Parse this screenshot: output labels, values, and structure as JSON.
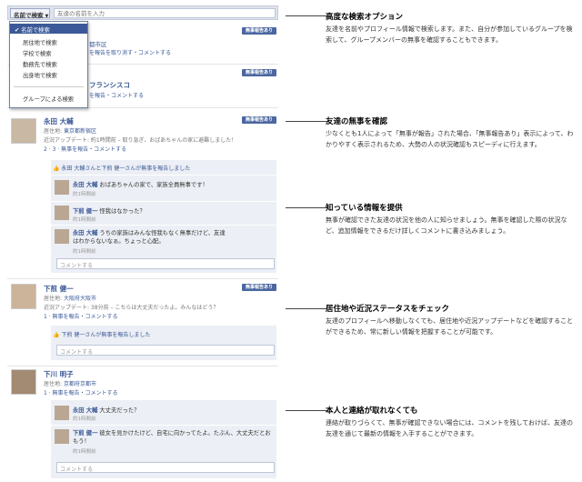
{
  "search": {
    "mode_label": "名前で検索",
    "placeholder": "友達の名前を入力",
    "dropdown": [
      "✔ 名前で検索",
      "居住地で検索",
      "学校で検索",
      "勤務先で検索",
      "出身地で検索",
      "グループによる検索"
    ]
  },
  "badge": "無事報告あり",
  "entries": [
    {
      "name": "",
      "line1": "都市区",
      "line2": "を報告を取り消す・コメントする"
    },
    {
      "name": "フランシスコ",
      "line1": "",
      "line2": "を報告・コメントする"
    },
    {
      "name": "永田 大輔",
      "residence_label": "居住地:",
      "residence": "東京都新宿区",
      "update": "近況アップデート: 約1時間前 – 取り急ぎ、おばあちゃんの家に避難しました！",
      "stats": "2 · 3 · 無事を報告・コメントする",
      "liked": "永田 大輔さんと下煎 健一さんが無事を報告しました",
      "comments": [
        {
          "name": "永田 大輔",
          "text": "おばあちゃんの家で、家族全員無事です！",
          "time": "約1時間前"
        },
        {
          "name": "下煎 健一",
          "text": "怪我はなかった？",
          "time": "約1時間前"
        },
        {
          "name": "永田 大輔",
          "text": "うちの家族はみんな怪我もなく無事だけど、友達はわからないなぁ。ちょっと心配。",
          "time": "約1時間前"
        }
      ],
      "comment_placeholder": "コメントする"
    },
    {
      "name": "下煎 健一",
      "residence_label": "居住地:",
      "residence": "大阪府大阪市",
      "update": "近況アップデート: 38分前 – こちらは大丈夫だったよ。みんなはどう？",
      "stats": "1 · 無事を報告・コメントする",
      "liked": "下煎 健一さんが無事を報告しました",
      "comment_placeholder": "コメントする"
    },
    {
      "name": "下川 明子",
      "residence_label": "居住地:",
      "residence": "京都府京都市",
      "stats": "1 · 無事を報告・コメントする",
      "comments": [
        {
          "name": "永田 大輔",
          "text": "大丈夫だった？",
          "time": "約1時間前"
        },
        {
          "name": "下煎 健一",
          "text": "彼女を見かけたけど、自宅に向かってたよ。たぶん、大丈夫だとおもう！",
          "time": "約1時間前"
        }
      ],
      "comment_placeholder": "コメントする"
    }
  ],
  "features": [
    {
      "title": "高度な検索オプション",
      "body": "友達を名前やプロフィール情報で検索します。また、自分が参加しているグループを検索して、グループメンバーの無事を確認することもできます。"
    },
    {
      "title": "友達の無事を確認",
      "body": "少なくとも1人によって「無事が報告」された場合、「無事報告あり」表示によって、わかりやすく表示されるため、大勢の人の状況確認もスピーディに行えます。"
    },
    {
      "title": "知っている情報を提供",
      "body": "無事が確認できた友達の状況を他の人に知らせましょう。無事を確認した際の状況など、追加情報をできるだけ詳しくコメントに書き込みましょう。"
    },
    {
      "title": "居住地や近況ステータスをチェック",
      "body": "友達のプロフィールへ移動しなくても、居住地や近況アップデートなどを確認することができるため、常に新しい情報を把握することが可能です。"
    },
    {
      "title": "本人と連絡が取れなくても",
      "body": "連絡が取りづらくて、無事が確認できない場合には、コメントを残しておけば、友達の友達を通じて最新の情報を入手することができます。"
    }
  ]
}
